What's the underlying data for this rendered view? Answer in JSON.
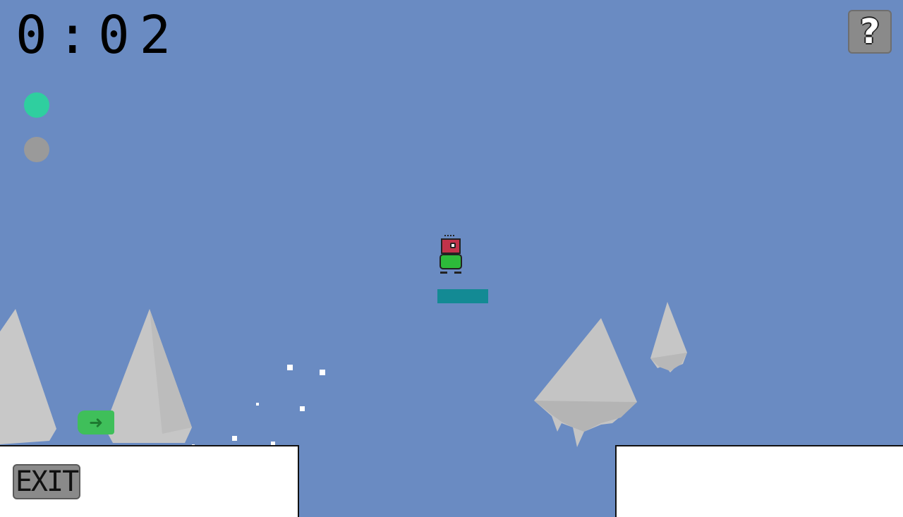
{
  "hud": {
    "timer": "0:02",
    "help_label": "?",
    "exit_label": "EXIT",
    "direction_icon": "arrow-right-icon",
    "collectibles": [
      {
        "state": "collected",
        "color": "#2fcf9f"
      },
      {
        "state": "remaining",
        "color": "#9a9a9a"
      }
    ]
  },
  "colors": {
    "sky": "#6a8bc2",
    "ground": "#ffffff",
    "platform": "#138a94",
    "rock": "#c8c8c8",
    "player_head": "#c2324a",
    "player_body": "#2dbb3a",
    "button": "#8a8a8a"
  }
}
